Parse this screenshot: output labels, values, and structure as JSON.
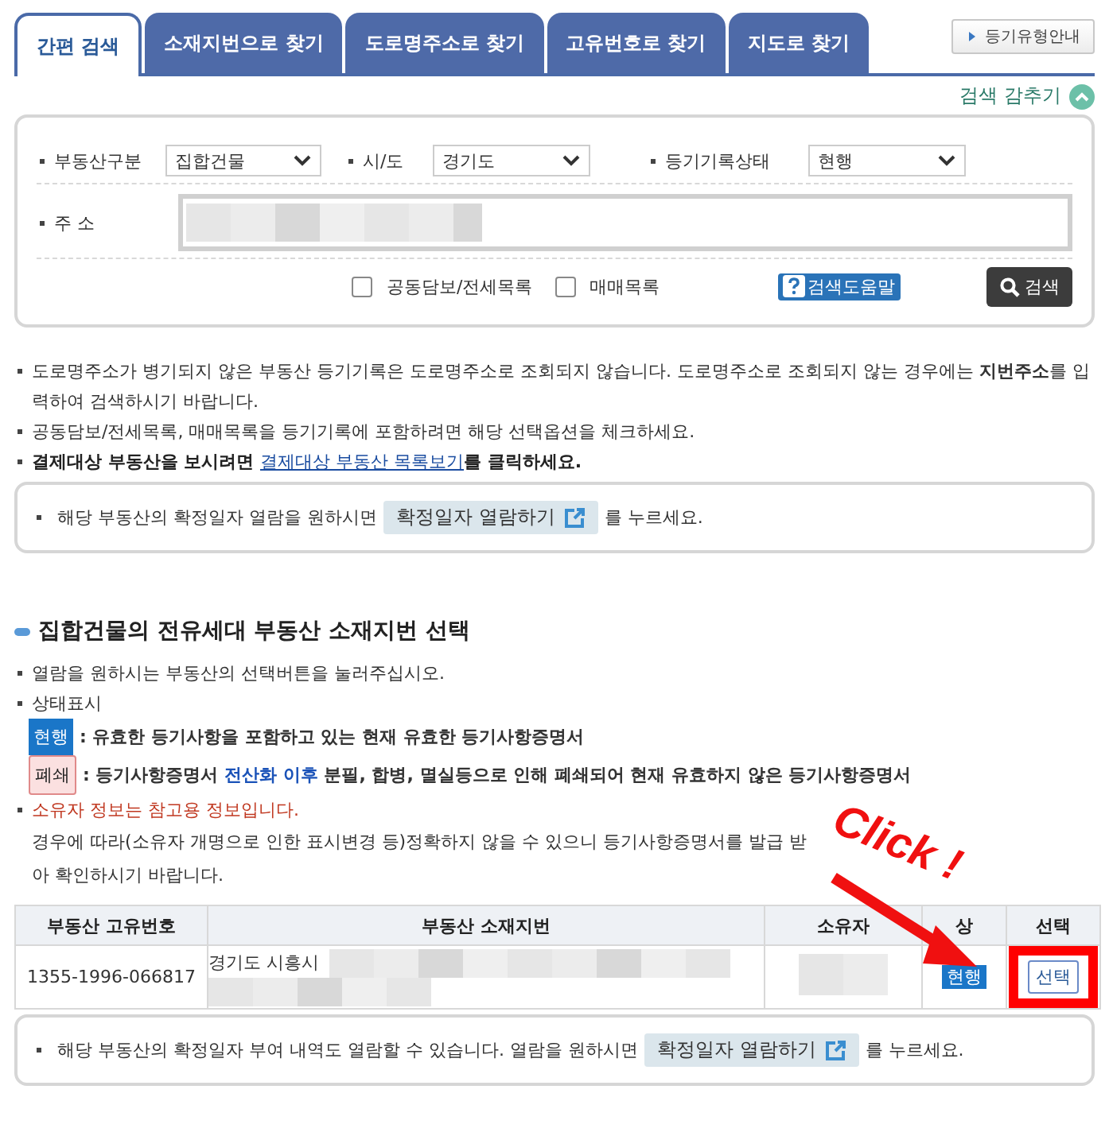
{
  "tabs": [
    {
      "label": "간편 검색",
      "selected": true
    },
    {
      "label": "소재지번으로 찾기",
      "selected": false
    },
    {
      "label": "도로명주소로 찾기",
      "selected": false
    },
    {
      "label": "고유번호로 찾기",
      "selected": false
    },
    {
      "label": "지도로 찾기",
      "selected": false
    }
  ],
  "guide_button": "등기유형안내",
  "toggle": {
    "label": "검색 감추기",
    "expanded": true
  },
  "search": {
    "selects": [
      {
        "label": "부동산구분",
        "value": "집합건물"
      },
      {
        "label": "시/도",
        "value": "경기도"
      },
      {
        "label": "등기기록상태",
        "value": "현행"
      }
    ],
    "address_label": "주 소",
    "options": [
      {
        "label": "공동담보/전세목록",
        "checked": false
      },
      {
        "label": "매매목록",
        "checked": false
      }
    ],
    "help": "검색도움말",
    "button": "검색"
  },
  "notes": [
    {
      "kind": "text",
      "text": "도로명주소가 병기되지 않은 부동산 등기기록은 도로명주소로 조회되지 않습니다. 도로명주소로 조회되지 않는 경우에는 **지번주소**를 입력하여 검색하시기 바랍니다."
    },
    {
      "kind": "text",
      "text": "공동담보/전세목록, 매매목록을 등기기록에 포함하려면 해당 선택옵션을 체크하세요."
    },
    {
      "kind": "link",
      "before": "결제대상 부동산을 보시려면 ",
      "link": "결제대상 부동산 목록보기",
      "after": "를 클릭하세요."
    }
  ],
  "notice_1": {
    "before": "해당 부동산의 확정일자 열람을 원하시면",
    "button": "확정일자 열람하기",
    "after": "를 누르세요."
  },
  "section_title": "집합건물의 전유세대 부동산 소재지번 선택",
  "instructions": [
    "열람을 원하시는 부동산의 선택버튼을 눌러주십시오.",
    "상태표시"
  ],
  "legend": [
    {
      "kind": "current",
      "badge": "현행",
      "before": ": 유효한 등기사항을 포함하고 있는 현재 유효한 등기사항증명서"
    },
    {
      "kind": "closed",
      "badge": "폐쇄",
      "before": ": 등기사항증명서 ",
      "highlight": "전산화 이후",
      "after": " 분필, 합병, 멸실등으로 인해 폐쇄되어 현재 유효하지 않은 등기사항증명서"
    }
  ],
  "owner_note": {
    "warning": "소유자 정보는 참고용 정보입니다.",
    "text": "경우에 따라(소유자 개명으로 인한 표시변경 등)정확하지 않을 수 있으니 등기사항증명서를 발급 받아 확인하시기 바랍니다."
  },
  "table": {
    "columns": [
      "부동산 고유번호",
      "부동산 소재지번",
      "소유자",
      "상",
      "선택"
    ],
    "rows": [
      {
        "id": "1355-1996-066817",
        "address": "경기도 시흥시",
        "status": {
          "kind": "current",
          "label": "현행"
        },
        "select": "선택",
        "highlighted": true
      }
    ]
  },
  "notice_2": {
    "before": "해당 부동산의 확정일자 부여 내역도 열람할 수 있습니다. 열람을 원하시면",
    "button": "확정일자 열람하기",
    "after": "를 누르세요."
  },
  "annotation": {
    "text": "Click !"
  }
}
